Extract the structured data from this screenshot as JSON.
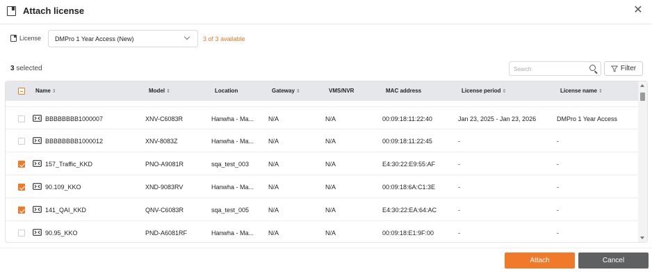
{
  "dialog": {
    "title": "Attach license",
    "close_glyph": "✕"
  },
  "license": {
    "label": "License",
    "selected": "DMPro 1 Year Access (New)",
    "available_count": "3",
    "available_total": "3",
    "available_text": "available"
  },
  "selection": {
    "count": "3",
    "text": "selected"
  },
  "search": {
    "placeholder": "Search",
    "value": ""
  },
  "filter": {
    "label": "Filter"
  },
  "colors": {
    "accent": "#f07a2a",
    "header_bg": "#e5e7ea",
    "cancel_bg": "#5f6062"
  },
  "table": {
    "columns": [
      "Name",
      "Model",
      "Location",
      "Gateway",
      "VMS/NVR",
      "MAC address",
      "License period",
      "License name"
    ],
    "sortable": [
      true,
      true,
      false,
      true,
      false,
      false,
      true,
      true
    ],
    "rows": [
      {
        "checked": false,
        "name": "BBBBBBBB1000007",
        "model": "XNV-C6083R",
        "location": "Hanwha - Ma...",
        "gateway": "N/A",
        "vms": "N/A",
        "mac": "00:09:18:11:22:40",
        "period": "Jan 23, 2025 - Jan 23, 2026",
        "license_name": "DMPro 1 Year Access"
      },
      {
        "checked": false,
        "name": "BBBBBBBB1000012",
        "model": "XNV-8083Z",
        "location": "Hanwha - Ma...",
        "gateway": "N/A",
        "vms": "N/A",
        "mac": "00:09:18:11:22:45",
        "period": "-",
        "license_name": "-"
      },
      {
        "checked": true,
        "name": "157_Traffic_KKD",
        "model": "PNO-A9081R",
        "location": "sqa_test_003",
        "gateway": "N/A",
        "vms": "N/A",
        "mac": "E4:30:22:E9:55:AF",
        "period": "-",
        "license_name": "-"
      },
      {
        "checked": true,
        "name": "90.109_KKO",
        "model": "XND-9083RV",
        "location": "Hanwha - Ma...",
        "gateway": "N/A",
        "vms": "N/A",
        "mac": "00:09:18:6A:C1:3E",
        "period": "-",
        "license_name": "-"
      },
      {
        "checked": true,
        "name": "141_QAI_KKD",
        "model": "QNV-C6083R",
        "location": "sqa_test_005",
        "gateway": "N/A",
        "vms": "N/A",
        "mac": "E4:30:22:EA:64:AC",
        "period": "-",
        "license_name": "-"
      },
      {
        "checked": false,
        "name": "90.95_KKO",
        "model": "PND-A6081RF",
        "location": "Hanwha - Ma...",
        "gateway": "N/A",
        "vms": "N/A",
        "mac": "00:09:18:E1:9F:00",
        "period": "-",
        "license_name": "-"
      }
    ]
  },
  "footer": {
    "attach_label": "Attach",
    "cancel_label": "Cancel"
  }
}
